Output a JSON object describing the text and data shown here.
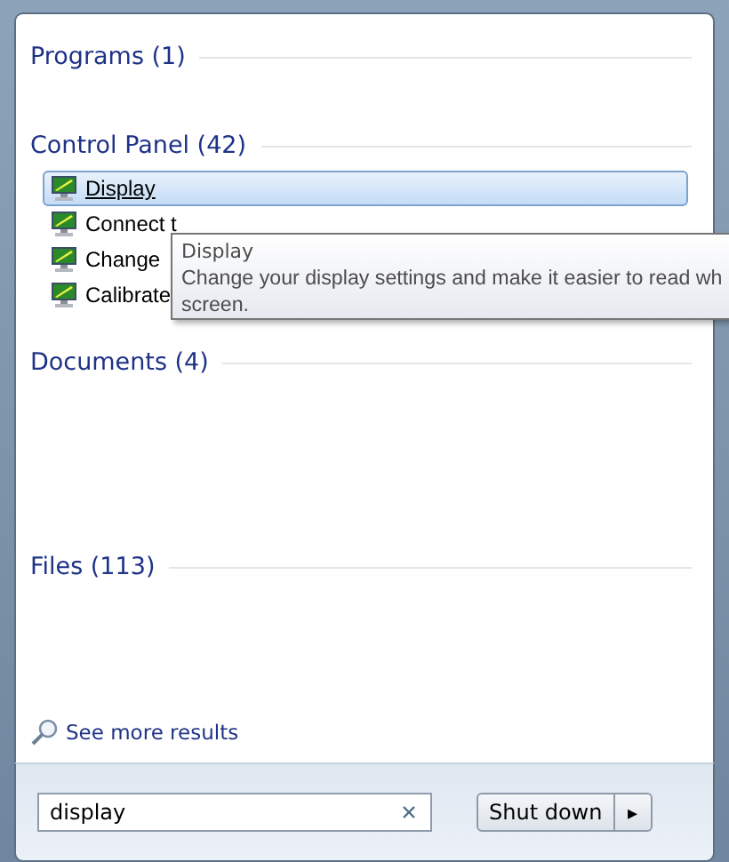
{
  "groups": [
    {
      "title": "Programs (1)"
    },
    {
      "title": "Control Panel (42)",
      "items": [
        {
          "label": "Display",
          "selected": true
        },
        {
          "label": "Connect t",
          "selected": false
        },
        {
          "label": "Change",
          "selected": false
        },
        {
          "label": "Calibrate",
          "selected": false
        }
      ]
    },
    {
      "title": "Documents (4)"
    },
    {
      "title": "Files (113)"
    }
  ],
  "tooltip": {
    "title": "Display",
    "lines": [
      "Change your display settings and make it easier to read wh",
      "screen."
    ]
  },
  "see_more": "See more results",
  "search": {
    "value": "display"
  },
  "shutdown": {
    "label": "Shut down",
    "arrow": "▸"
  }
}
